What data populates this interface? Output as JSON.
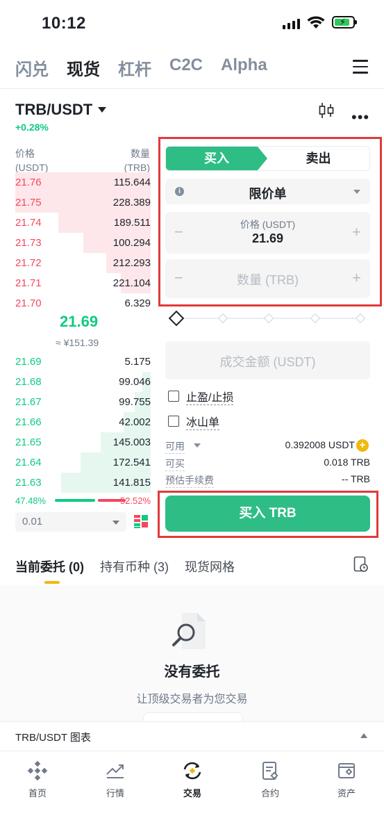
{
  "status": {
    "time": "10:12"
  },
  "topnav": {
    "tabs": [
      "闪兑",
      "现货",
      "杠杆",
      "C2C",
      "Alpha"
    ],
    "active": "现货"
  },
  "pair": {
    "symbol": "TRB/USDT",
    "change": "+0.28%"
  },
  "orderbook": {
    "price_label": "价格",
    "price_unit": "(USDT)",
    "qty_label": "数量",
    "qty_unit": "(TRB)",
    "asks": [
      {
        "price": "21.76",
        "qty": "115.644",
        "depth": 1.0
      },
      {
        "price": "21.75",
        "qty": "228.389",
        "depth": 1.0
      },
      {
        "price": "21.74",
        "qty": "189.511",
        "depth": 0.68
      },
      {
        "price": "21.73",
        "qty": "100.294",
        "depth": 0.5
      },
      {
        "price": "21.72",
        "qty": "212.293",
        "depth": 0.33
      },
      {
        "price": "21.71",
        "qty": "221.104",
        "depth": 0.22
      },
      {
        "price": "21.70",
        "qty": "6.329",
        "depth": 0.0
      }
    ],
    "last_price": "21.69",
    "last_price_cny": "≈ ¥151.39",
    "bids": [
      {
        "price": "21.69",
        "qty": "5.175",
        "depth": 0.0
      },
      {
        "price": "21.68",
        "qty": "99.046",
        "depth": 0.06
      },
      {
        "price": "21.67",
        "qty": "99.755",
        "depth": 0.12
      },
      {
        "price": "21.66",
        "qty": "42.002",
        "depth": 0.2
      },
      {
        "price": "21.65",
        "qty": "145.003",
        "depth": 0.37
      },
      {
        "price": "21.64",
        "qty": "172.541",
        "depth": 0.52
      },
      {
        "price": "21.63",
        "qty": "141.815",
        "depth": 0.66
      }
    ],
    "buy_ratio": "47.48%",
    "sell_ratio": "52.52%",
    "precision": "0.01"
  },
  "order_form": {
    "buy_tab": "买入",
    "sell_tab": "卖出",
    "order_type": "限价单",
    "price_label": "价格 (USDT)",
    "price_value": "21.69",
    "qty_placeholder": "数量 (TRB)",
    "total_placeholder": "成交金额 (USDT)",
    "tp_sl": "止盈/止损",
    "iceberg": "冰山单",
    "available_label": "可用",
    "available_value": "0.392008 USDT",
    "can_buy_label": "可买",
    "can_buy_value": "0.018 TRB",
    "fee_label": "预估手续费",
    "fee_value": "-- TRB",
    "submit": "买入 TRB"
  },
  "orders_tabs": {
    "open": "当前委托 (0)",
    "holdings": "持有币种 (3)",
    "grid": "现货网格"
  },
  "empty": {
    "title": "没有委托",
    "subtitle": "让顶级交易者为您交易"
  },
  "chart_bar": {
    "label": "TRB/USDT 图表"
  },
  "bottomnav": {
    "items": [
      "首页",
      "行情",
      "交易",
      "合约",
      "资产"
    ],
    "active": "交易"
  },
  "colors": {
    "up": "#0ecb81",
    "down": "#f6465d",
    "accent": "#2ebd85",
    "highlight": "#e03a3a",
    "brand": "#f0b90b"
  }
}
